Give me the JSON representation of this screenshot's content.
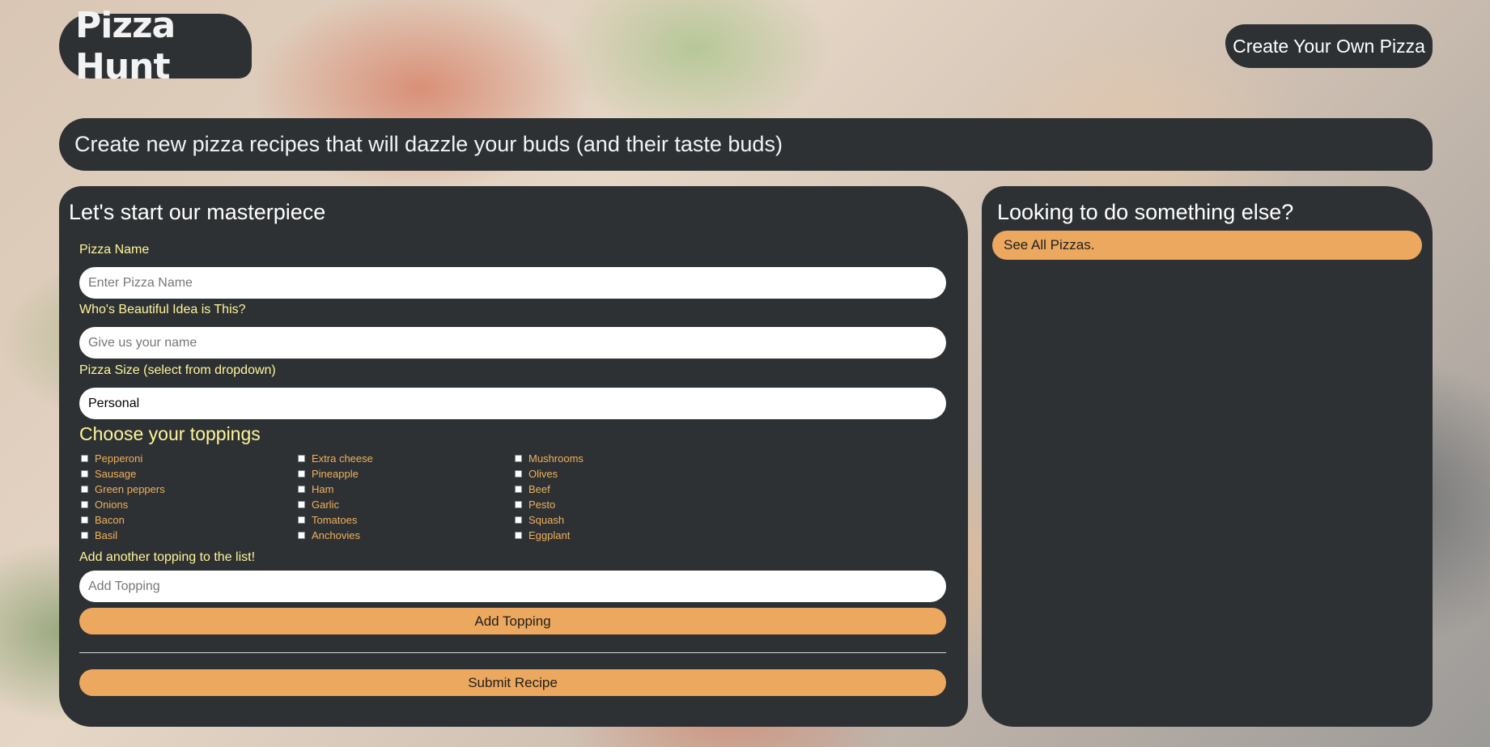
{
  "header": {
    "brand": "Pizza Hunt",
    "nav_create": "Create Your Own Pizza"
  },
  "hero": {
    "tagline": "Create new pizza recipes that will dazzle your buds (and their taste buds)"
  },
  "form": {
    "title": "Let's start our masterpiece",
    "pizza_name_label": "Pizza Name",
    "pizza_name_placeholder": "Enter Pizza Name",
    "creator_label": "Who's Beautiful Idea is This?",
    "creator_placeholder": "Give us your name",
    "size_label": "Pizza Size (select from dropdown)",
    "size_value": "Personal",
    "toppings_title": "Choose your toppings",
    "toppings": [
      "Pepperoni",
      "Extra cheese",
      "Mushrooms",
      "Sausage",
      "Pineapple",
      "Olives",
      "Green peppers",
      "Ham",
      "Beef",
      "Onions",
      "Garlic",
      "Pesto",
      "Bacon",
      "Tomatoes",
      "Squash",
      "Basil",
      "Anchovies",
      "Eggplant"
    ],
    "add_topping_label": "Add another topping to the list!",
    "add_topping_placeholder": "Add Topping",
    "add_topping_button": "Add Topping",
    "submit_button": "Submit Recipe"
  },
  "sidebar": {
    "title": "Looking to do something else?",
    "see_all": "See All Pizzas."
  },
  "colors": {
    "panel": "#2d3134",
    "accent": "#eca85e",
    "label_yellow": "#fff59a",
    "topping_orange": "#f0b05c"
  }
}
